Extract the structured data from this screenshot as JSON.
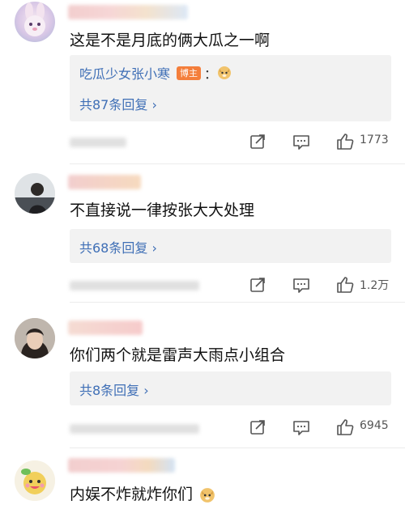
{
  "comments": [
    {
      "text": "这是不是月底的俩大瓜之一啊",
      "reply_preview": {
        "author": "吃瓜少女张小寒",
        "badge": "博主",
        "sep": "："
      },
      "reply_count": "共87条回复 ›",
      "likes": "1773"
    },
    {
      "text": "不直接说一律按张大大处理",
      "reply_count": "共68条回复 ›",
      "likes": "1.2万"
    },
    {
      "text": "你们两个就是雷声大雨点小组合",
      "reply_count": "共8条回复 ›",
      "likes": "6945"
    },
    {
      "text": "内娱不炸就炸你们"
    }
  ],
  "icons": {
    "share": "share-icon",
    "comment": "comment-icon",
    "like": "thumbs-up-icon",
    "emoji": "doge-emoji-icon"
  },
  "colors": {
    "link": "#3f6fb6",
    "badge": "#f47e3b",
    "reply_bg": "#f2f2f2"
  }
}
